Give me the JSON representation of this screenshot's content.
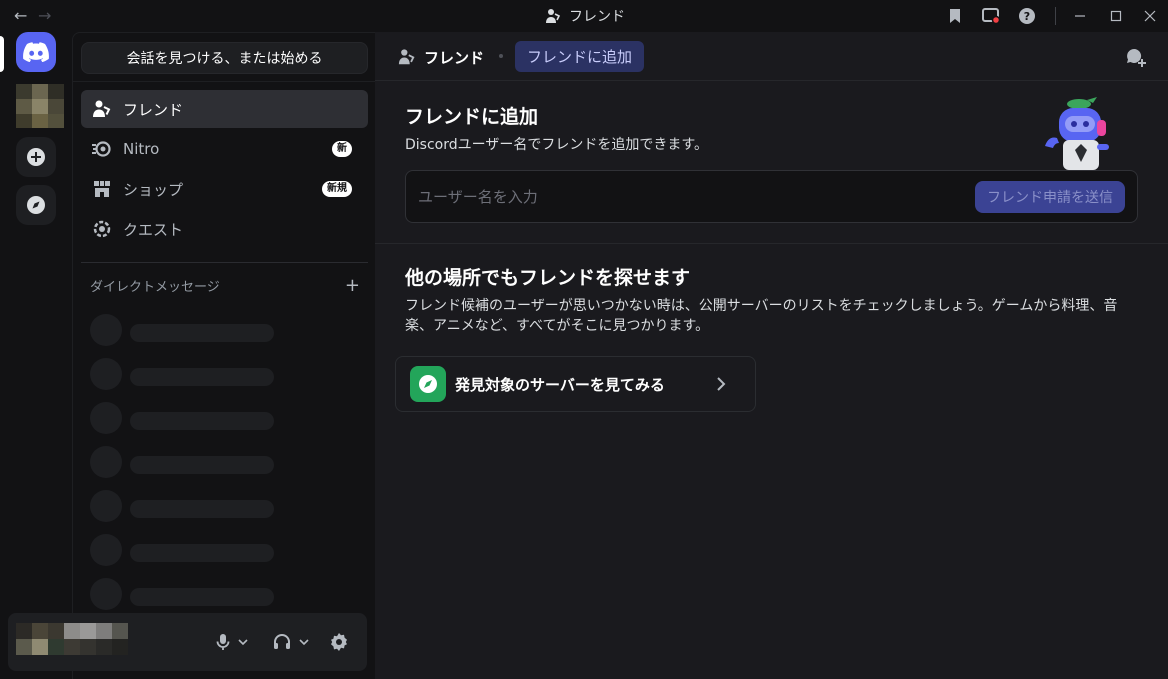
{
  "titlebar": {
    "title": "フレンド",
    "icons": [
      "arrow-left-icon",
      "arrow-right-icon",
      "friends-icon",
      "bookmark-icon",
      "screen-share-icon",
      "help-icon",
      "minimize-icon",
      "maximize-icon",
      "close-icon"
    ]
  },
  "sidebar": {
    "search_label": "会話を見つける、または始める",
    "nav": [
      {
        "label": "フレンド",
        "badge": ""
      },
      {
        "label": "Nitro",
        "badge": "新"
      },
      {
        "label": "ショップ",
        "badge": "新規"
      },
      {
        "label": "クエスト",
        "badge": ""
      }
    ],
    "dm_header": "ダイレクトメッセージ",
    "dm_add": "+"
  },
  "main": {
    "header_title": "フレンド",
    "header_tab": "フレンドに追加",
    "add_friend": {
      "title": "フレンドに追加",
      "description": "Discordユーザー名でフレンドを追加できます。",
      "placeholder": "ユーザー名を入力",
      "send_label": "フレンド申請を送信"
    },
    "other_places": {
      "title": "他の場所でもフレンドを探せます",
      "description": "フレンド候補のユーザーが思いつかない時は、公開サーバーのリストをチェックしましょう。ゲームから料理、音楽、アニメなど、すべてがそこに見つかります。",
      "explore_label": "発見対象のサーバーを見てみる"
    }
  },
  "colors": {
    "accent": "#5865f2",
    "explore_green": "#23a55a",
    "background": "#1a1a1e",
    "sidebar": "#121214",
    "notification_red": "#f23f43"
  }
}
